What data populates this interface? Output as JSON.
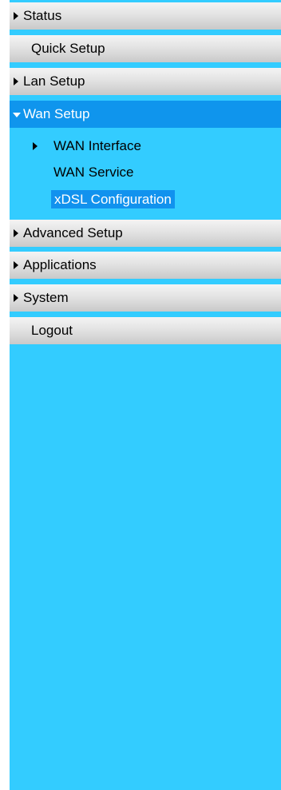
{
  "menu": {
    "items": [
      {
        "label": "Status"
      },
      {
        "label": "Quick Setup"
      },
      {
        "label": "Lan Setup"
      },
      {
        "label": "Wan Setup"
      },
      {
        "label": "Advanced Setup"
      },
      {
        "label": "Applications"
      },
      {
        "label": "System"
      },
      {
        "label": "Logout"
      }
    ],
    "wan_sub": [
      {
        "label": "WAN Interface"
      },
      {
        "label": "WAN Service"
      },
      {
        "label": "xDSL Configuration"
      }
    ]
  },
  "colors": {
    "menu_background": "#33ccff",
    "active_item": "#0f95ed",
    "selected_subitem": "#1192ee"
  }
}
